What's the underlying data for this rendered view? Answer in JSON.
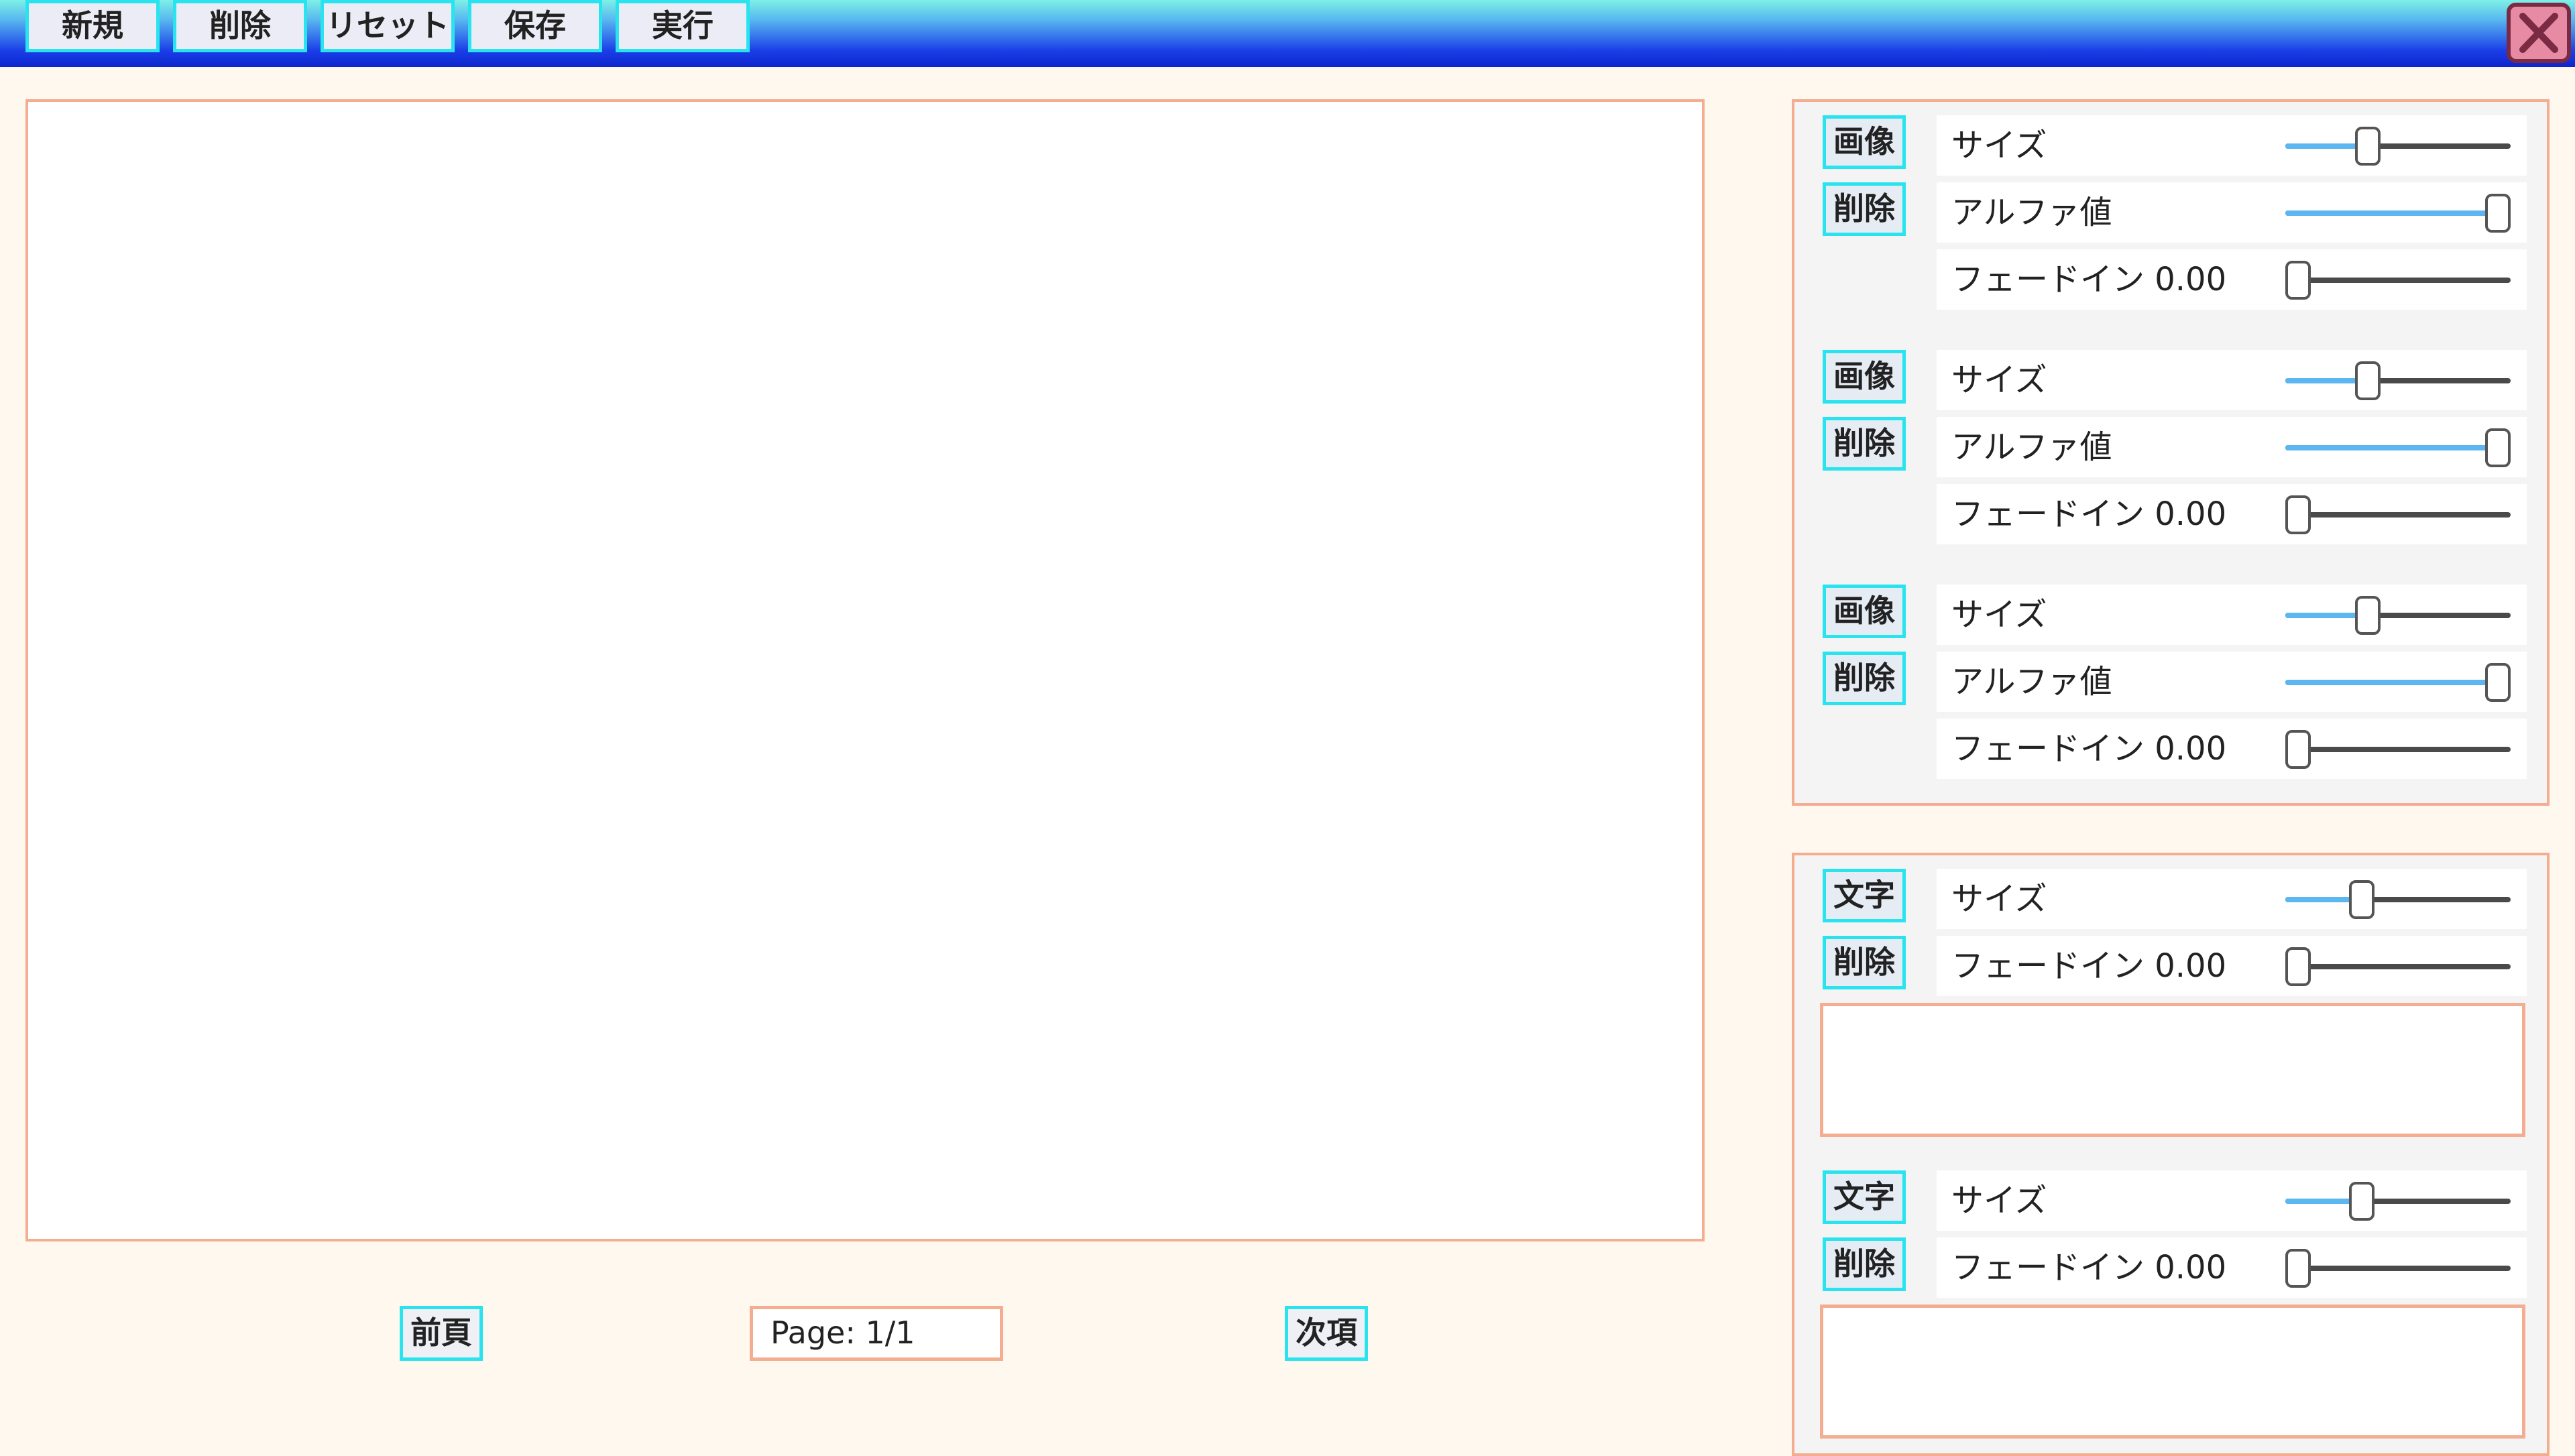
{
  "toolbar": {
    "new_label": "新規",
    "delete_label": "削除",
    "reset_label": "リセット",
    "save_label": "保存",
    "run_label": "実行",
    "close_icon": "close-icon"
  },
  "pager": {
    "prev_label": "前頁",
    "page_text": "Page: 1/1",
    "next_label": "次項"
  },
  "image_layers": [
    {
      "image_label": "画像",
      "delete_label": "削除",
      "size_label": "サイズ",
      "size_value": 0.35,
      "alpha_label": "アルファ値",
      "alpha_value": 1.0,
      "fade_label": "フェードイン 0.00",
      "fade_value": 0.0
    },
    {
      "image_label": "画像",
      "delete_label": "削除",
      "size_label": "サイズ",
      "size_value": 0.35,
      "alpha_label": "アルファ値",
      "alpha_value": 1.0,
      "fade_label": "フェードイン 0.00",
      "fade_value": 0.0
    },
    {
      "image_label": "画像",
      "delete_label": "削除",
      "size_label": "サイズ",
      "size_value": 0.35,
      "alpha_label": "アルファ値",
      "alpha_value": 1.0,
      "fade_label": "フェードイン 0.00",
      "fade_value": 0.0
    }
  ],
  "text_layers": [
    {
      "text_label": "文字",
      "delete_label": "削除",
      "size_label": "サイズ",
      "size_value": 0.32,
      "fade_label": "フェードイン 0.00",
      "fade_value": 0.0,
      "text": ""
    },
    {
      "text_label": "文字",
      "delete_label": "削除",
      "size_label": "サイズ",
      "size_value": 0.32,
      "fade_label": "フェードイン 0.00",
      "fade_value": 0.0,
      "text": ""
    }
  ],
  "colors": {
    "accent_border": "#29e3ee",
    "frame_border": "#f5ad91",
    "slider_fill": "#5cb6f0"
  }
}
